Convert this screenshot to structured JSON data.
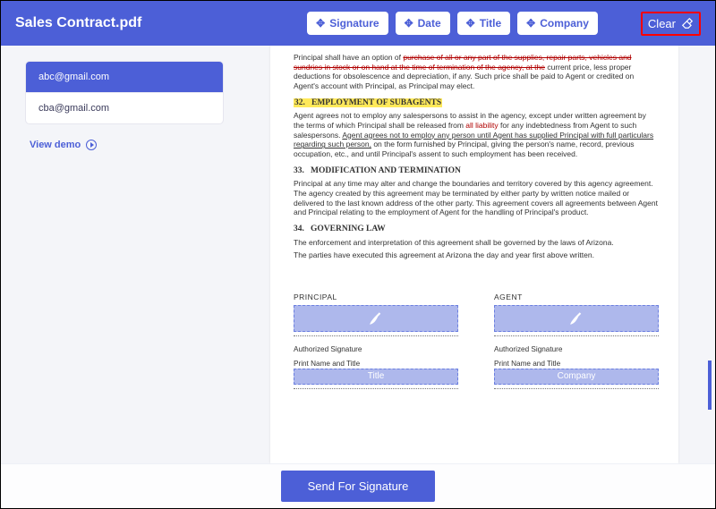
{
  "title": "Sales Contract.pdf",
  "toolbar": {
    "signature": "Signature",
    "date": "Date",
    "title": "Title",
    "company": "Company",
    "clear": "Clear"
  },
  "sidebar": {
    "emails": [
      "abc@gmail.com",
      "cba@gmail.com"
    ],
    "selected_index": 0,
    "view_demo": "View demo"
  },
  "document": {
    "para_top": "Principal shall have an option of purchase of all or any part of the supplies, repair parts, vehicles and sundries in stock or on hand at the time of termination of the agency, at the current price, less proper deductions for obsolescence and depreciation, if any. Such price shall be paid to Agent or credited on Agent's account with Principal, as Principal may elect.",
    "s32_num": "32.",
    "s32_title": "EMPLOYMENT OF SUBAGENTS",
    "s32_body_1": "Agent agrees not to employ any salespersons to assist in the agency, except under written agreement by the terms of which Principal shall be released from ",
    "s32_body_red": "all liability",
    "s32_body_2": " for any indebtedness from Agent to such salespersons. ",
    "s32_body_ul": "Agent agrees not to employ any person until Agent has supplied Principal with full particulars regarding such person,",
    "s32_body_3": " on the form furnished by Principal, giving the person's name, record, previous occupation, etc., and until Principal's assent to such employment has been received.",
    "s33_num": "33.",
    "s33_title": "MODIFICATION AND TERMINATION",
    "s33_body": "Principal at any time may alter and change the boundaries and territory covered by this agency agreement. The agency created by this agreement may be terminated by either party by written notice mailed or delivered to the last known address of the other party. This agreement covers all agreements between Agent and Principal relating to the employment of Agent for the handling of Principal's product.",
    "s34_num": "34.",
    "s34_title": "GOVERNING LAW",
    "s34_body_1": "The enforcement and interpretation of this agreement shall be governed by the laws of Arizona.",
    "s34_body_2": "The parties have executed this agreement at Arizona the day and year first above written.",
    "principal_label": "PRINCIPAL",
    "agent_label": "AGENT",
    "auth_sig": "Authorized Signature",
    "print_name": "Print Name and Title",
    "placeholder_title": "Title",
    "placeholder_company": "Company"
  },
  "footer": {
    "send": "Send For Signature"
  }
}
